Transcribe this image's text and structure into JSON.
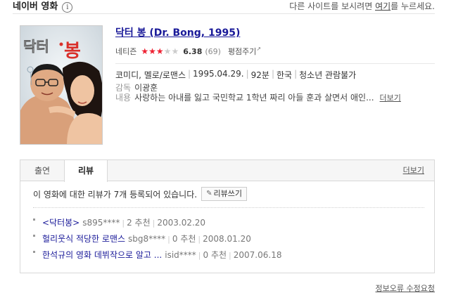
{
  "header": {
    "title": "네이버 영화",
    "info_icon": "i",
    "note_prefix": "다른 사이트를 보시려면 ",
    "note_link": "여기",
    "note_suffix": "를 누르세요."
  },
  "poster": {
    "title_text": "닥터봉",
    "accent_color": "#d9302b"
  },
  "movie": {
    "title": "닥터 봉 (Dr. Bong, 1995)",
    "rating_label": "네티즌",
    "stars_filled": 3,
    "stars_total": 5,
    "score": "6.38",
    "count": "(69)",
    "rate_link": "평점주기",
    "genre": "코미디, 멜로/로맨스",
    "release_date": "1995.04.29.",
    "runtime": "92분",
    "country": "한국",
    "age_rating": "청소년 관람불가",
    "director_label": "감독",
    "director": "이광훈",
    "synopsis_label": "내용",
    "synopsis": "사랑하는 아내를 잃고 국민학교 1학년 짜리 아들 훈과 살면서 애인...",
    "more_link": "더보기"
  },
  "tabs": {
    "cast": "출연",
    "review": "리뷰",
    "more": "더보기"
  },
  "reviews": {
    "summary": "이 영화에 대한 리뷰가 7개 등록되어 있습니다.",
    "write_button": "리뷰쓰기",
    "items": [
      {
        "title": "<닥터봉>",
        "user": "s895****",
        "recommend": "2 추천",
        "date": "2003.02.20"
      },
      {
        "title": "헐리웃식 적당한 로맨스",
        "user": "sbg8****",
        "recommend": "0 추천",
        "date": "2008.01.20"
      },
      {
        "title": "한석규의 영화 데뷔작으로 알고 ...",
        "user": "isid****",
        "recommend": "0 추천",
        "date": "2007.06.18"
      }
    ]
  },
  "footer": {
    "report_link": "정보오류 수정요청"
  }
}
